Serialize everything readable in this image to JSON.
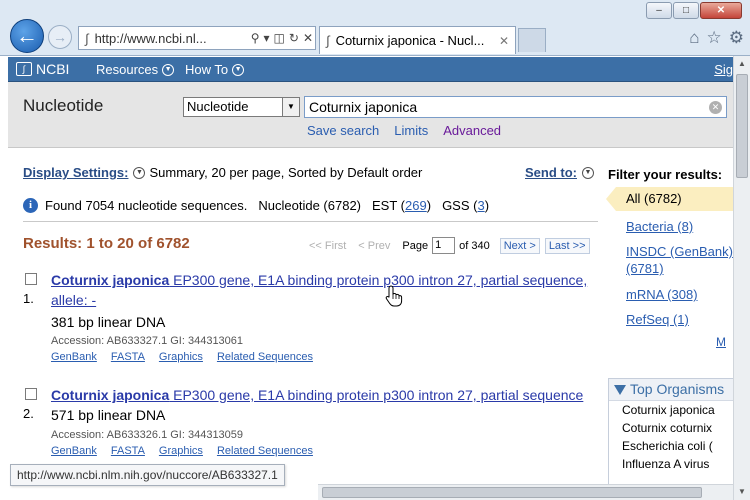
{
  "browser": {
    "url": "http://www.ncbi.nl...",
    "tab_title": "Coturnix japonica - Nucl...",
    "status_url": "http://www.ncbi.nlm.nih.gov/nuccore/AB633327.1"
  },
  "ncbi_bar": {
    "logo": "NCBI",
    "menu": [
      "Resources",
      "How To"
    ],
    "signin": "Sig"
  },
  "search": {
    "db_title": "Nucleotide",
    "db_selected": "Nucleotide",
    "term": "Coturnix japonica",
    "links": [
      "Save search",
      "Limits",
      "Advanced"
    ]
  },
  "display": {
    "settings_label": "Display Settings:",
    "settings_value": "Summary, 20 per page, Sorted by Default order",
    "send_to": "Send to:"
  },
  "found": {
    "text": "Found 7054 nucleotide sequences.",
    "nucleotide": "Nucleotide (6782)",
    "est_label": "EST (",
    "est_count": "269",
    "gss_label": "GSS (",
    "gss_count": "3",
    "close_paren": ")"
  },
  "results": {
    "title": "Results: 1 to 20 of 6782",
    "pager": {
      "first": "<< First",
      "prev": "< Prev",
      "page_label": "Page",
      "page_value": "1",
      "of": "of 340",
      "next": "Next >",
      "last": "Last >>"
    },
    "items": [
      {
        "num": "1.",
        "organism": "Coturnix japonica",
        "title_rest": " EP300 gene, E1A binding protein p300 intron 27, partial sequence, allele: -",
        "length": "381 bp linear DNA",
        "accession": "Accession: AB633327.1   GI: 344313061",
        "links": [
          "GenBank",
          "FASTA",
          "Graphics",
          "Related Sequences"
        ]
      },
      {
        "num": "2.",
        "organism": "Coturnix japonica",
        "title_rest": " EP300 gene, E1A binding protein p300 intron 27, partial sequence",
        "length": "571 bp linear DNA",
        "accession": "Accession: AB633326.1   GI: 344313059",
        "links": [
          "GenBank",
          "FASTA",
          "Graphics",
          "Related Sequences"
        ]
      }
    ]
  },
  "sidebar": {
    "filter_title": "Filter your results:",
    "all": "All (6782)",
    "filters": [
      "Bacteria (8)",
      "INSDC (GenBank) (6781)",
      "mRNA (308)",
      "RefSeq (1)"
    ],
    "more": "M",
    "top_org_title": "Top Organisms",
    "organisms": [
      "Coturnix japonica",
      "Coturnix coturnix",
      "Escherichia coli (",
      "Influenza A virus"
    ]
  }
}
